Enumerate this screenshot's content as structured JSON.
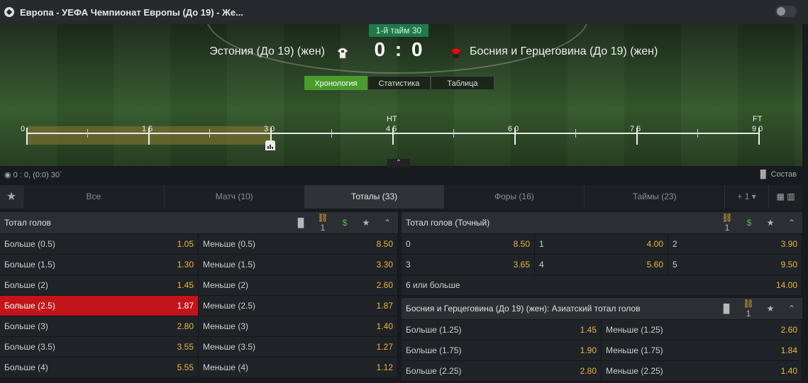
{
  "header": {
    "title": "Европа - УЕФА Чемпионат Европы (До 19) - Же..."
  },
  "match": {
    "timer": "1-й тайм 30",
    "home": "Эстония (До 19) (жен)",
    "away": "Босния и Герцеговина (До 19) (жен)",
    "score": "0 : 0",
    "view_tabs": [
      "Хронология",
      "Статистика",
      "Таблица"
    ]
  },
  "timeline": {
    "labels": [
      "0",
      "1 5",
      "3 0",
      "4 5",
      "6 0",
      "7 5",
      "9 0"
    ],
    "ht": "HT",
    "ft": "FT",
    "progress": 0.333
  },
  "info": {
    "left": "0 : 0, (0:0) 30`",
    "right": "Состав"
  },
  "categories": [
    {
      "label": "Все"
    },
    {
      "label": "Матч (10)"
    },
    {
      "label": "Тоталы (33)"
    },
    {
      "label": "Форы (16)"
    },
    {
      "label": "Таймы (23)"
    },
    {
      "label": "+ 1"
    }
  ],
  "total_goals": {
    "title": "Тотал голов",
    "link_count": "1",
    "rows": [
      [
        {
          "n": "Больше (0.5)",
          "o": "1.05"
        },
        {
          "n": "Меньше (0.5)",
          "o": "8.50"
        }
      ],
      [
        {
          "n": "Больше (1.5)",
          "o": "1.30"
        },
        {
          "n": "Меньше (1.5)",
          "o": "3.30"
        }
      ],
      [
        {
          "n": "Больше (2)",
          "o": "1.45"
        },
        {
          "n": "Меньше (2)",
          "o": "2.60"
        }
      ],
      [
        {
          "n": "Больше (2.5)",
          "o": "1.87"
        },
        {
          "n": "Меньше (2.5)",
          "o": "1.87"
        }
      ],
      [
        {
          "n": "Больше (3)",
          "o": "2.80"
        },
        {
          "n": "Меньше (3)",
          "o": "1.40"
        }
      ],
      [
        {
          "n": "Больше (3.5)",
          "o": "3.55"
        },
        {
          "n": "Меньше (3.5)",
          "o": "1.27"
        }
      ],
      [
        {
          "n": "Больше (4)",
          "o": "5.55"
        },
        {
          "n": "Меньше (4)",
          "o": "1.12"
        }
      ]
    ]
  },
  "exact_total": {
    "title": "Тотал голов (Точный)",
    "link_count": "1",
    "rows": [
      [
        {
          "n": "0",
          "o": "8.50"
        },
        {
          "n": "1",
          "o": "4.00"
        },
        {
          "n": "2",
          "o": "3.90"
        }
      ],
      [
        {
          "n": "3",
          "o": "3.65"
        },
        {
          "n": "4",
          "o": "5.60"
        },
        {
          "n": "5",
          "o": "9.50"
        }
      ],
      [
        {
          "n": "6 или больше",
          "o": "14.00"
        }
      ]
    ]
  },
  "asian_total": {
    "title": "Босния и Герцеговина (До 19) (жен): Азиатский тотал голов",
    "link_count": "1",
    "rows": [
      [
        {
          "n": "Больше (1.25)",
          "o": "1.45"
        },
        {
          "n": "Меньше (1.25)",
          "o": "2.60"
        }
      ],
      [
        {
          "n": "Больше (1.75)",
          "o": "1.90"
        },
        {
          "n": "Меньше (1.75)",
          "o": "1.84"
        }
      ],
      [
        {
          "n": "Больше (2.25)",
          "o": "2.80"
        },
        {
          "n": "Меньше (2.25)",
          "o": "1.40"
        }
      ]
    ]
  }
}
